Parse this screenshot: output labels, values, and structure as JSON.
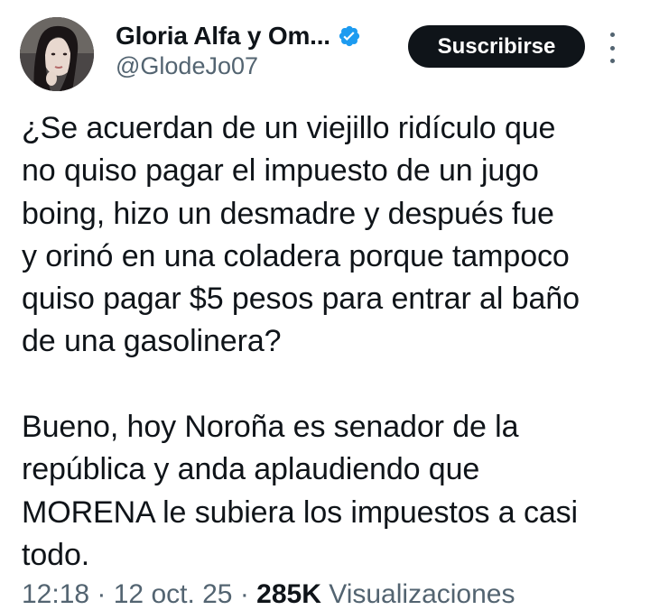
{
  "author": {
    "display_name": "Gloria Alfa y Om...",
    "handle": "@GlodeJo07",
    "verified": true,
    "verified_icon": "verified-badge-icon",
    "verified_color": "#1d9bf0"
  },
  "actions": {
    "subscribe_label": "Suscribirse",
    "more_icon": "more-vertical-icon"
  },
  "tweet": {
    "paragraph_1": [
      "¿Se acuerdan de un viejillo ridículo que",
      "no quiso pagar el impuesto de un jugo",
      "boing, hizo un desmadre y después fue",
      "y orinó en una coladera porque tampoco",
      "quiso pagar $5 pesos para entrar al baño",
      "de una gasolinera?"
    ],
    "paragraph_2": [
      "Bueno, hoy Noroña es senador de la",
      "república y anda aplaudiendo que",
      "MORENA le subiera los impuestos a casi",
      "todo."
    ]
  },
  "meta": {
    "timestamp": "12:18 · 12 oct. 25",
    "views_count": "285K",
    "views_label": "Visualizaciones"
  },
  "colors": {
    "text_primary": "#0f1419",
    "text_secondary": "#536471",
    "button_bg": "#0f1419",
    "button_text": "#ffffff"
  }
}
